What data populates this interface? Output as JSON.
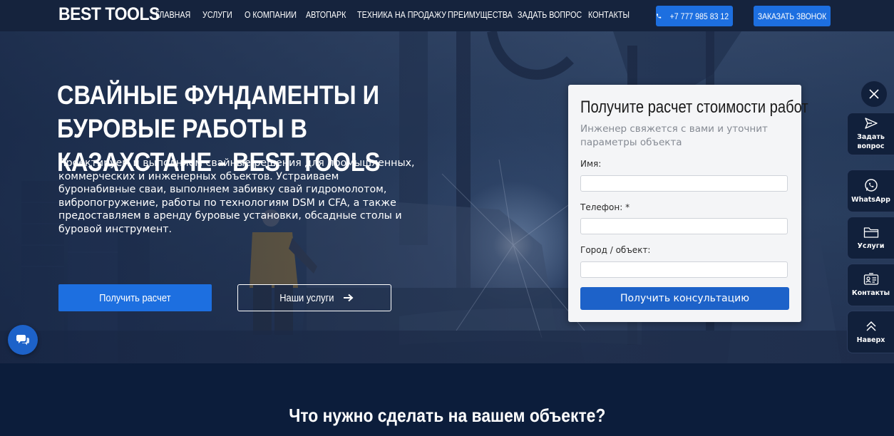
{
  "header": {
    "logo": "BEST TOOLS",
    "nav": [
      {
        "label": "ГЛАВНАЯ"
      },
      {
        "label": "УСЛУГИ"
      },
      {
        "label": "О КОМПАНИИ"
      },
      {
        "label": "АВТОПАРК"
      },
      {
        "label": "ТЕХНИКА НА ПРОДАЖУ"
      },
      {
        "label": "ПРЕИМУЩЕСТВА"
      },
      {
        "label": "ЗАДАТЬ ВОПРОС"
      },
      {
        "label": "КОНТАКТЫ"
      }
    ],
    "phone": "+7 777 985 83 12",
    "call_label": "ЗАКАЗАТЬ ЗВОНОК"
  },
  "hero": {
    "title": "СВАЙНЫЕ ФУНДАМЕНТЫ И БУРОВЫЕ РАБОТЫ В КАЗАХСТАНЕ - BEST TOOLS",
    "description": "Проектируем и выполняем свайные решения для промышленных, коммерческих и инженерных объектов. Устраиваем буронабивные сваи, выполняем забивку свай гидромолотом, вибропогружение, работы по технологиям DSM и CFA, а также предоставляем в аренду буровые установки, обсадные столы и буровой инструмент.",
    "btn_primary": "Получить расчет",
    "btn_secondary": "Наши услуги"
  },
  "form": {
    "title": "Получите расчет стоимости работ",
    "subtitle": "Инженер свяжется с вами и уточнит параметры объекта",
    "fields": [
      {
        "label": "Имя:",
        "value": ""
      },
      {
        "label": "Телефон: *",
        "value": ""
      },
      {
        "label": "Город / объект:",
        "value": ""
      }
    ],
    "submit": "Получить консультацию"
  },
  "sidebar": {
    "items": [
      {
        "label": "Задать вопрос",
        "icon": "send-icon"
      },
      {
        "label": "WhatsApp",
        "icon": "whatsapp-icon"
      },
      {
        "label": "Услуги",
        "icon": "folder-icon"
      },
      {
        "label": "Контакты",
        "icon": "contact-card-icon"
      },
      {
        "label": "Наверх",
        "icon": "chevrons-up-icon"
      }
    ]
  },
  "section": {
    "title": "Что нужно сделать на вашем объекте?"
  },
  "colors": {
    "accent": "#1d6fe0",
    "header_bg": "#15233d",
    "section_bg": "#0c1d3b",
    "form_bg": "#f4f5f7"
  }
}
